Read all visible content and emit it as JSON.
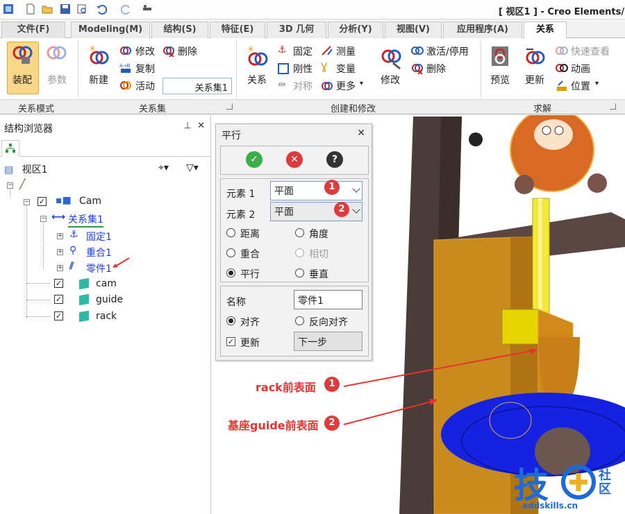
{
  "window": {
    "title": "[ 视区1 ] - Creo Elements/"
  },
  "tabs": [
    {
      "label": "文件(F)"
    },
    {
      "label": "Modeling(M)"
    },
    {
      "label": "结构(S)"
    },
    {
      "label": "特征(E)"
    },
    {
      "label": "3D 几何"
    },
    {
      "label": "分析(Y)"
    },
    {
      "label": "视图(V)"
    },
    {
      "label": "应用程序(A)"
    },
    {
      "label": "关系"
    }
  ],
  "ribbon": {
    "mode_group": {
      "label": "关系模式",
      "assembly": "装配",
      "parameters": "参数"
    },
    "set_group": {
      "label": "关系集",
      "new": "新建",
      "modify": "修改",
      "delete": "删除",
      "copy": "复制",
      "active": "活动",
      "combo_value": "关系集1"
    },
    "create_group": {
      "label": "创建和修改",
      "relation": "关系",
      "fix": "固定",
      "measure": "测量",
      "rigid": "刚性",
      "variable": "变量",
      "symmetric": "对称",
      "more": "更多",
      "modify": "修改",
      "activate": "激活/停用",
      "delete": "删除"
    },
    "solve_group": {
      "label": "求解",
      "preview": "预览",
      "update": "更新",
      "quick_view": "快速查看",
      "animation": "动画",
      "position": "位置"
    }
  },
  "browser": {
    "title": "结构浏览器",
    "view": "视区1",
    "tree": {
      "root": "Cam",
      "set": "关系集1",
      "fix": "固定1",
      "coincide": "重合1",
      "part": "零件1",
      "parts": [
        "cam",
        "guide",
        "rack"
      ]
    }
  },
  "dialog": {
    "title": "平行",
    "element1_label": "元素 1",
    "element1_value": "平面",
    "element2_label": "元素 2",
    "element2_value": "平面",
    "options": {
      "distance": "距离",
      "angle": "角度",
      "coincide": "重合",
      "tangent": "相切",
      "parallel": "平行",
      "perpendicular": "垂直"
    },
    "name_label": "名称",
    "name_value": "零件1",
    "align": "对齐",
    "reverse_align": "反向对齐",
    "update": "更新",
    "next": "下一步"
  },
  "annotations": {
    "badge1": "1",
    "badge2": "2",
    "rack_face": "rack前表面",
    "guide_face": "基座guide前表面"
  },
  "watermark": {
    "main": "技",
    "sub": "社区",
    "url": "addskills.cn"
  }
}
